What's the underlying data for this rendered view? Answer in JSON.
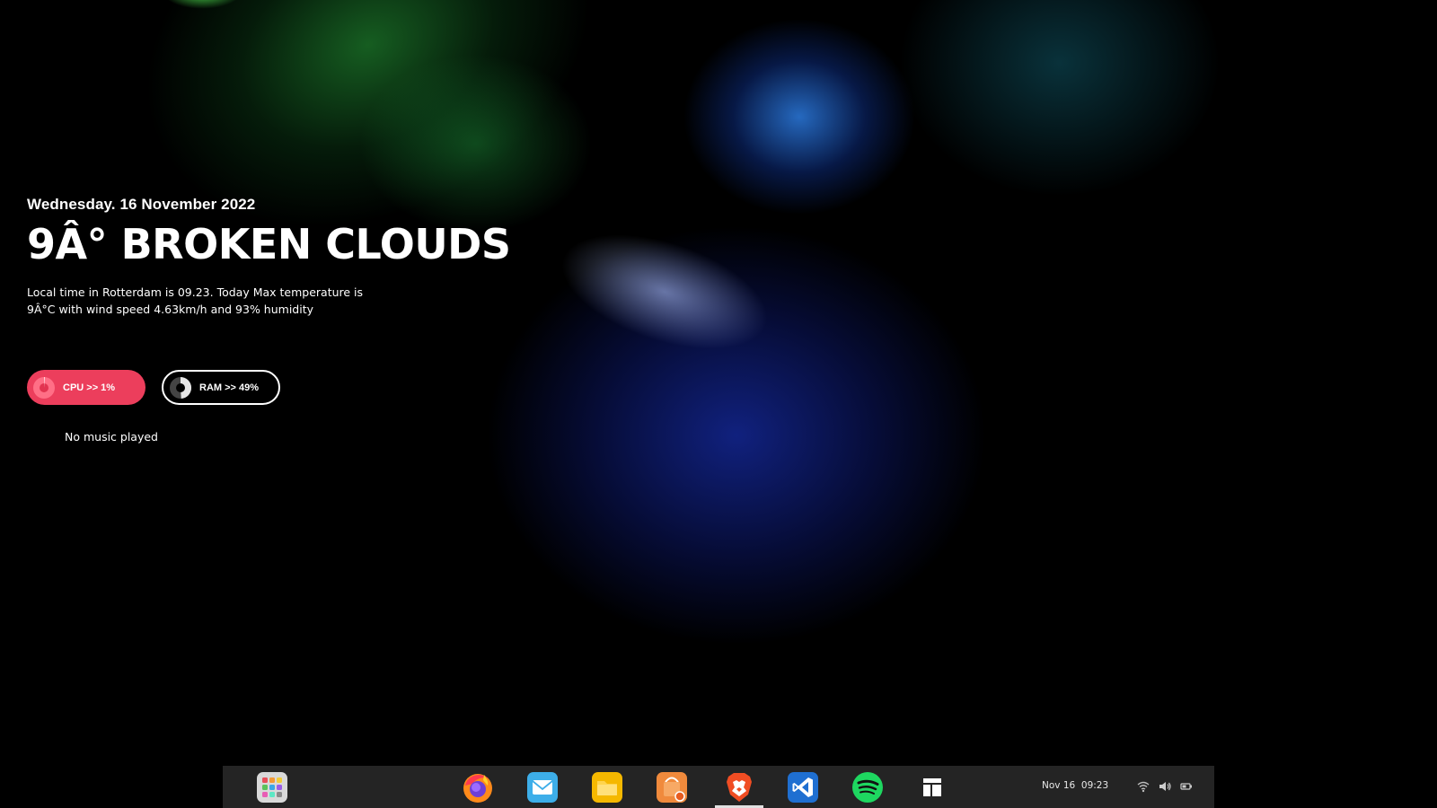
{
  "widget": {
    "date": "Wednesday. 16 November 2022",
    "weather_headline": "9Â° BROKEN CLOUDS",
    "description_line1": "Local time in Rotterdam  is 09.23. Today Max temperature is",
    "description_line2": "9Â°C with wind speed 4.63km/h and 93% humidity",
    "cpu_label": "CPU >> 1%",
    "cpu_percent": 1,
    "ram_label": "RAM >> 49%",
    "ram_percent": 49,
    "music_status": "No music played"
  },
  "dock": {
    "apps": [
      {
        "name": "app-grid-icon"
      },
      {
        "name": "firefox-icon"
      },
      {
        "name": "mail-icon"
      },
      {
        "name": "files-icon"
      },
      {
        "name": "software-store-icon"
      },
      {
        "name": "brave-browser-icon",
        "active": true
      },
      {
        "name": "vscode-icon"
      },
      {
        "name": "spotify-icon"
      },
      {
        "name": "window-layout-icon"
      }
    ],
    "clock_date": "Nov 16",
    "clock_time": "09:23"
  },
  "colors": {
    "cpu_pill": "#ec3e5c",
    "dock_background": "#242424",
    "spotify": "#1ed760",
    "vscode": "#1f6fd1",
    "brave": "#f04d23",
    "files": "#f5b800"
  }
}
